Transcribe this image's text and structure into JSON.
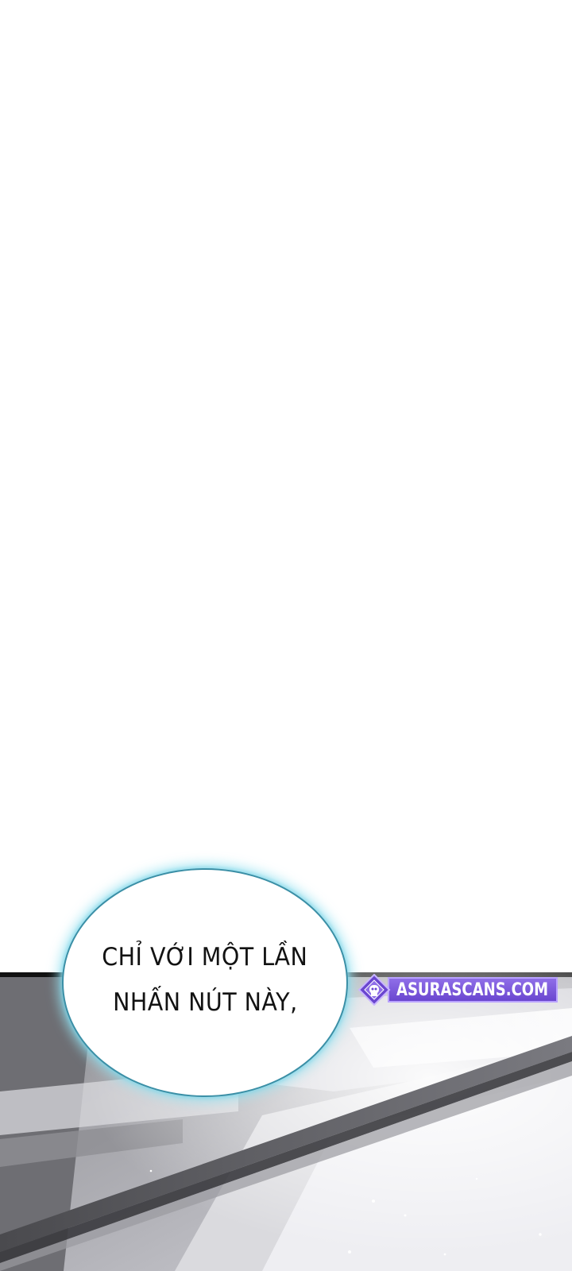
{
  "speech_bubble": {
    "lines": [
      "CHỈ VỚI MỘT LẦN",
      "NHẤN NÚT NÀY,"
    ]
  },
  "watermark": {
    "text": "ASURASCANS.COM"
  },
  "colors": {
    "background": "#ffffff",
    "bubble_border": "#3b8fa6",
    "bubble_glow": "#96e1f0",
    "watermark_fill": "#7a56db",
    "art_gray_dark": "#1c1c1c",
    "art_gray_light": "#e6e6ea"
  },
  "icons": {
    "watermark_logo": "asura-logo-icon"
  }
}
